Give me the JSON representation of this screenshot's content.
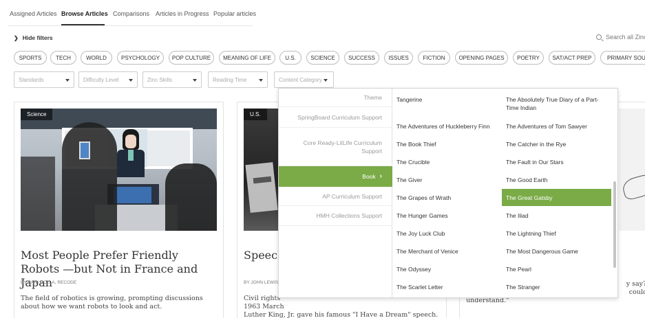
{
  "nav": {
    "tabs": [
      {
        "label": "Assigned Articles"
      },
      {
        "label": "Browse Articles"
      },
      {
        "label": "Comparisons"
      },
      {
        "label": "Articles in Progress"
      },
      {
        "label": "Popular articles"
      }
    ],
    "active_tab": "Browse Articles"
  },
  "filters": {
    "hide_label": "Hide filters",
    "search_placeholder": "Search all Zinc"
  },
  "pills": [
    "SPORTS",
    "TECH",
    "WORLD",
    "PSYCHOLOGY",
    "POP CULTURE",
    "MEANING OF LIFE",
    "U.S.",
    "SCIENCE",
    "SUCCESS",
    "ISSUES",
    "FICTION",
    "OPENING PAGES",
    "POETRY",
    "SAT/ACT PREP",
    "PRIMARY SOURC"
  ],
  "selects": [
    "Standards",
    "Difficulty Level",
    "Zinc Skills",
    "Reading Time",
    "Content Category"
  ],
  "cards": [
    {
      "tag": "Science",
      "title": "Most People Prefer Friendly Robots —but Not in France and Japan",
      "byline": "BY RANI MOLLA, RECODE",
      "description": "The field of robotics is growing, prompting discussions about how we want robots to look and act."
    },
    {
      "tag": "U.S.",
      "title": "Speech",
      "byline": "BY JOHN LEWIS,",
      "description": "Civil rights\n1963 March\nLuther King, Jr. gave his famous \"I Have a Dream\" speech."
    },
    {
      "tag": "",
      "title": "",
      "byline": "",
      "description": "y say? In\ncould \"r\nunderstand.\""
    }
  ],
  "panel": {
    "categories": [
      {
        "label": "Theme"
      },
      {
        "label": "SpringBoard Curriculum Support"
      },
      {
        "label": "Core Ready-LitLife Curriculum Support"
      },
      {
        "label": "Book"
      },
      {
        "label": "AP Curriculum Support"
      },
      {
        "label": "HMH Collections Support"
      }
    ],
    "active_category": "Book",
    "books_col1": [
      "Tangerine",
      "The Adventures of Huckleberry Finn",
      "The Book Thief",
      "The Crucible",
      "The Giver",
      "The Grapes of Wrath",
      "The Hunger Games",
      "The Joy Luck Club",
      "The Merchant of Venice",
      "The Odyssey",
      "The Scarlet Letter"
    ],
    "books_col2": [
      "The Absolutely True Diary of a Part-Time Indian",
      "The Adventures of Tom Sawyer",
      "The Catcher in the Rye",
      "The Fault in Our Stars",
      "The Good Earth",
      "The Great Gatsby",
      "The Iliad",
      "The Lightning Thief",
      "The Most Dangerous Game",
      "The Pearl",
      "The Stranger"
    ],
    "active_book": "The Great Gatsby"
  },
  "colors": {
    "accent_green": "#7aab47"
  },
  "icons": {
    "hide_filters": "chevron-down-icon",
    "search": "search-icon",
    "category_arrow": "chevron-right-icon"
  }
}
